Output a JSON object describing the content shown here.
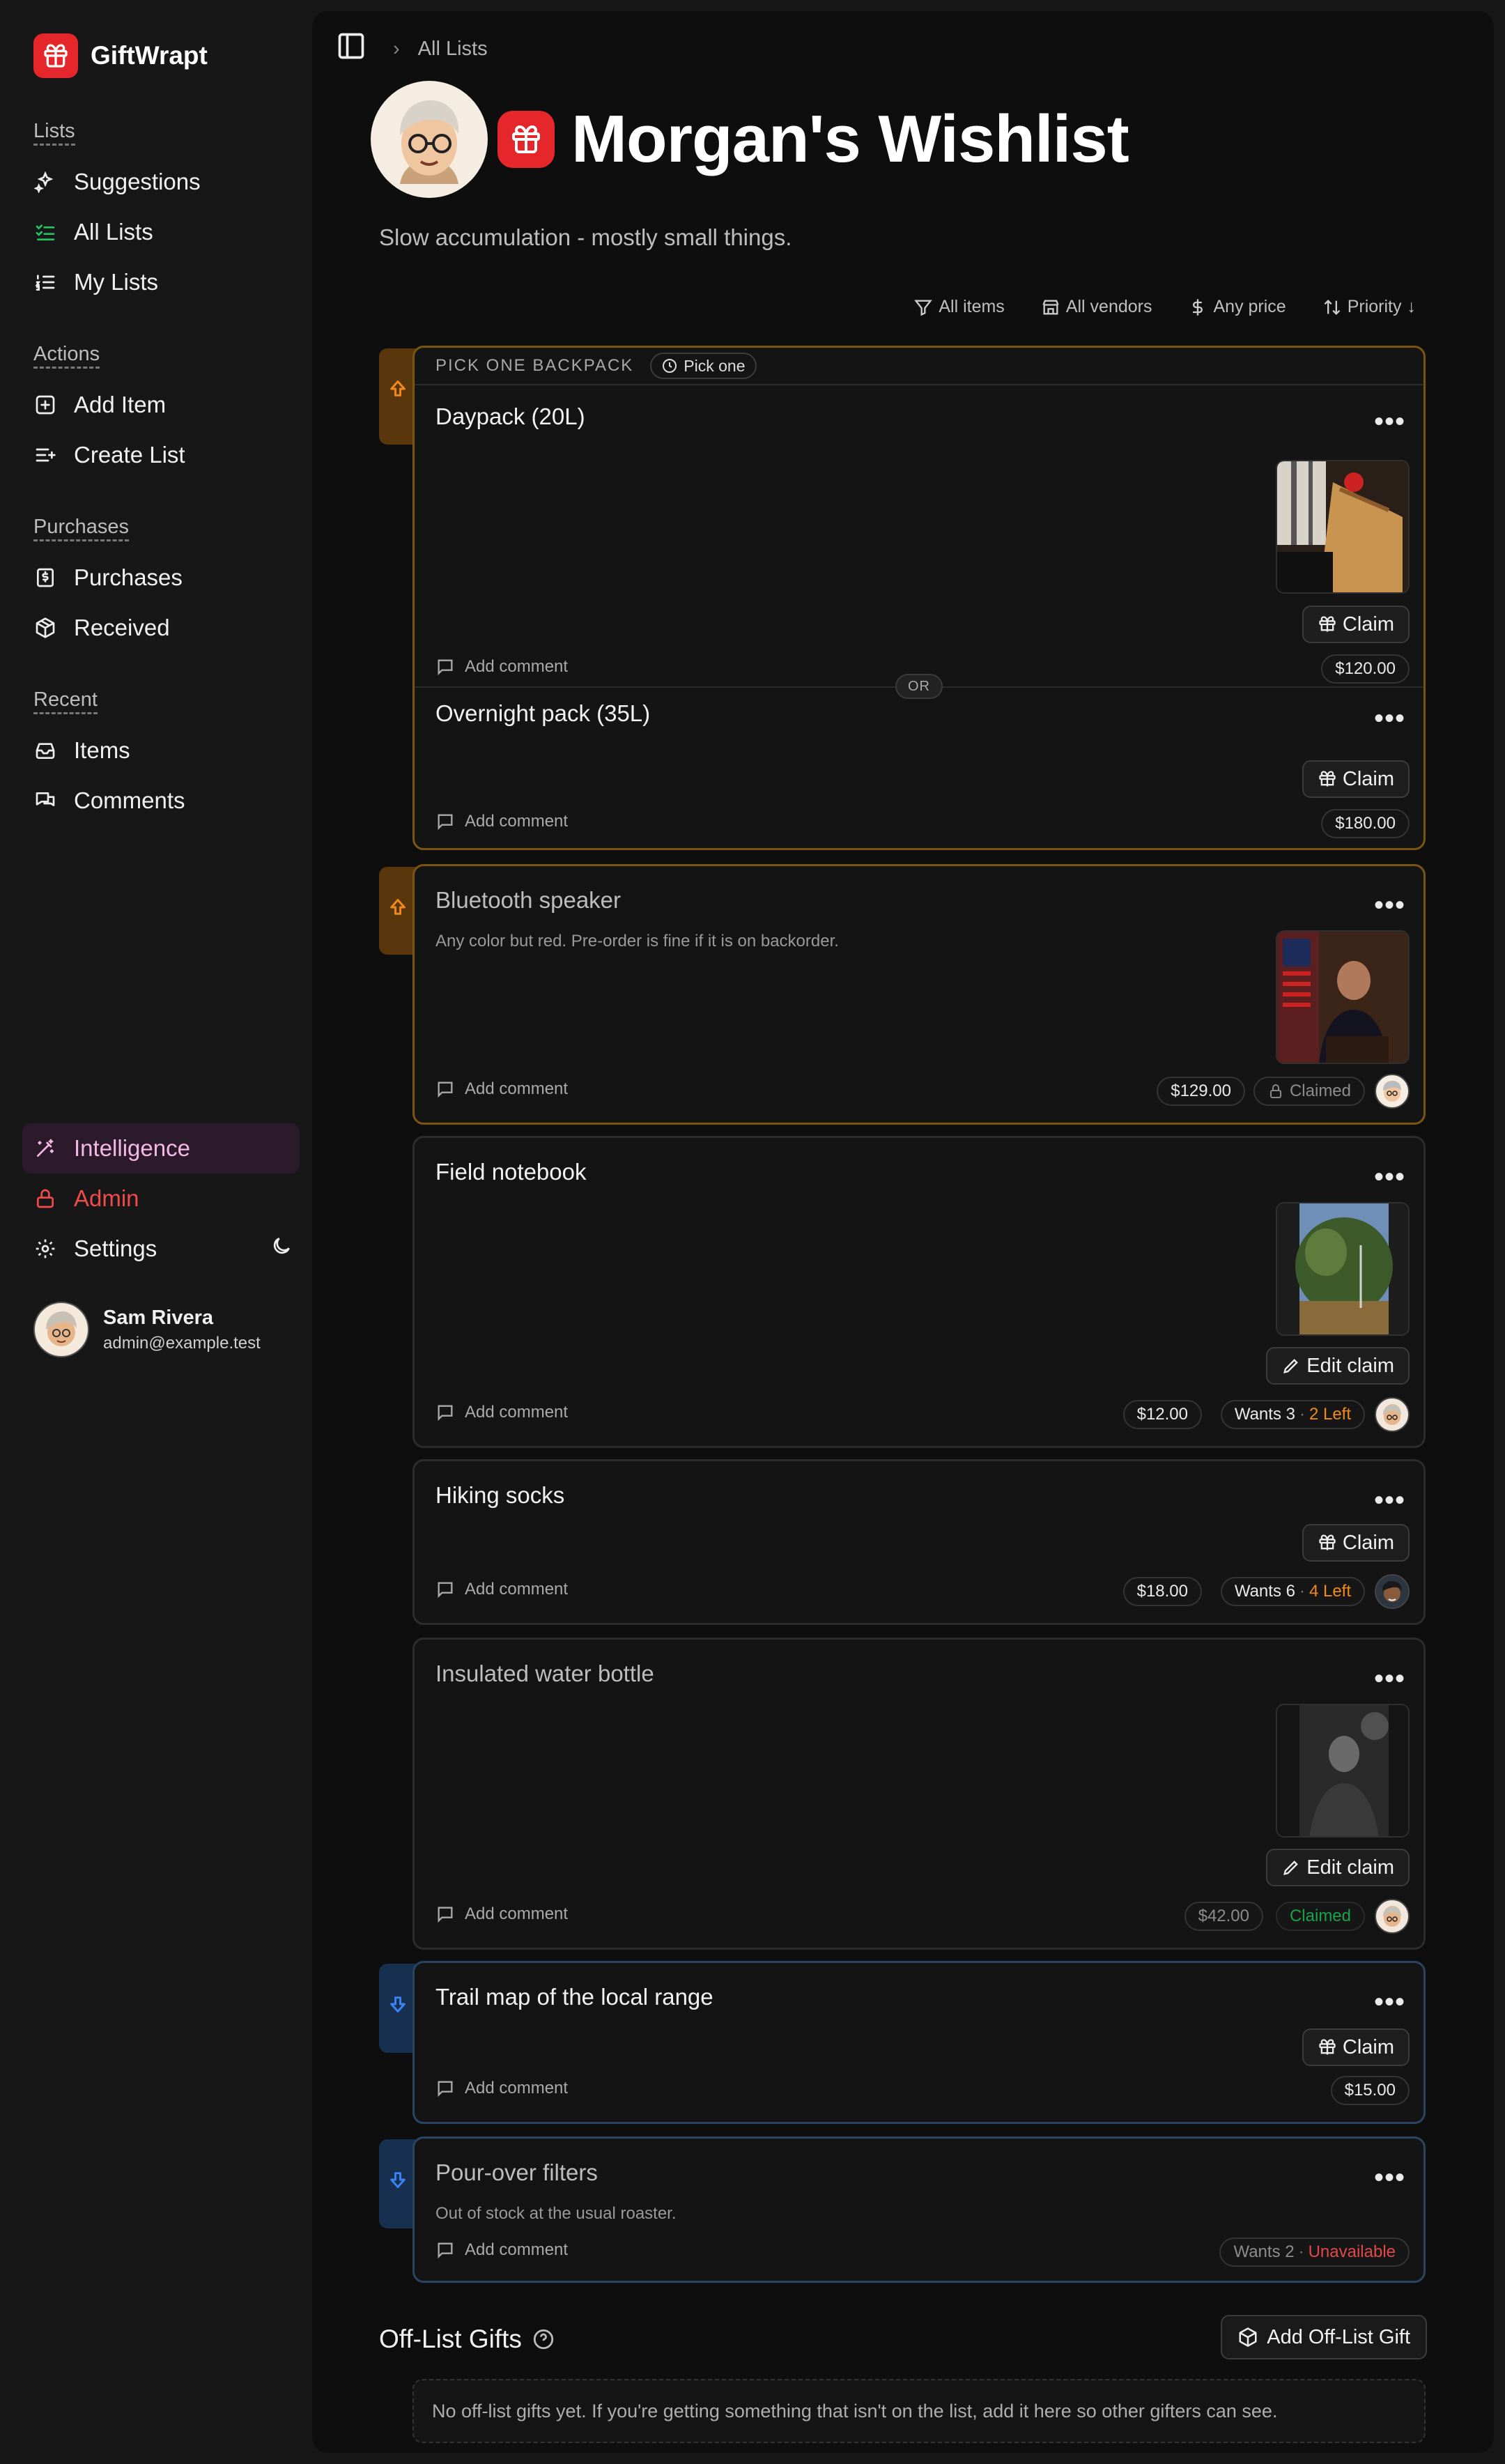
{
  "app": {
    "name": "GiftWrapt"
  },
  "sidebar": {
    "lists_heading": "Lists",
    "lists": [
      {
        "label": "Suggestions",
        "icon": "sparkles-icon"
      },
      {
        "label": "All Lists",
        "icon": "list-check-icon"
      },
      {
        "label": "My Lists",
        "icon": "numbered-list-icon"
      }
    ],
    "actions_heading": "Actions",
    "actions": [
      {
        "label": "Add Item",
        "icon": "plus-square-icon"
      },
      {
        "label": "Create List",
        "icon": "list-plus-icon"
      }
    ],
    "purchases_heading": "Purchases",
    "purchases": [
      {
        "label": "Purchases",
        "icon": "receipt-icon"
      },
      {
        "label": "Received",
        "icon": "package-icon"
      }
    ],
    "recent_heading": "Recent",
    "recent": [
      {
        "label": "Items",
        "icon": "inbox-icon"
      },
      {
        "label": "Comments",
        "icon": "comments-icon"
      }
    ],
    "intelligence": "Intelligence",
    "admin": "Admin",
    "settings": "Settings",
    "user": {
      "name": "Sam Rivera",
      "email": "admin@example.test"
    }
  },
  "breadcrumb": {
    "current": "All Lists"
  },
  "list": {
    "title": "Morgan's Wishlist",
    "description": "Slow accumulation - mostly small things."
  },
  "filters": {
    "items": "All items",
    "vendors": "All vendors",
    "price": "Any price",
    "sort": "Priority"
  },
  "group": {
    "heading": "PICK ONE BACKPACK",
    "badge": "Pick one",
    "or_label": "OR",
    "items": [
      {
        "title": "Daypack (20L)",
        "action": "Claim",
        "price": "$120.00",
        "comment": "Add comment"
      },
      {
        "title": "Overnight pack (35L)",
        "action": "Claim",
        "price": "$180.00",
        "comment": "Add comment"
      }
    ]
  },
  "items": [
    {
      "title": "Bluetooth speaker",
      "note": "Any color but red. Pre-order is fine if it is on backorder.",
      "price": "$129.00",
      "status": "Claimed",
      "comment": "Add comment"
    },
    {
      "title": "Field notebook",
      "action": "Edit claim",
      "price": "$12.00",
      "wants": "Wants 3",
      "left": "2 Left",
      "comment": "Add comment"
    },
    {
      "title": "Hiking socks",
      "action": "Claim",
      "price": "$18.00",
      "wants": "Wants 6",
      "left": "4 Left",
      "comment": "Add comment"
    },
    {
      "title": "Insulated water bottle",
      "action": "Edit claim",
      "price": "$42.00",
      "status": "Claimed",
      "comment": "Add comment"
    },
    {
      "title": "Trail map of the local range",
      "action": "Claim",
      "price": "$15.00",
      "comment": "Add comment"
    },
    {
      "title": "Pour-over filters",
      "note": "Out of stock at the usual roaster.",
      "wants": "Wants 2",
      "unavailable": "Unavailable",
      "comment": "Add comment"
    }
  ],
  "offlist": {
    "title": "Off-List Gifts",
    "button": "Add Off-List Gift",
    "empty": "No off-list gifts yet. If you're getting something that isn't on the list, add it here so other gifters can see."
  },
  "colors": {
    "brand": "#e5262a",
    "accent_orange": "#f08a1c",
    "claimed_green": "#17a34a",
    "unavailable_red": "#e14848"
  }
}
